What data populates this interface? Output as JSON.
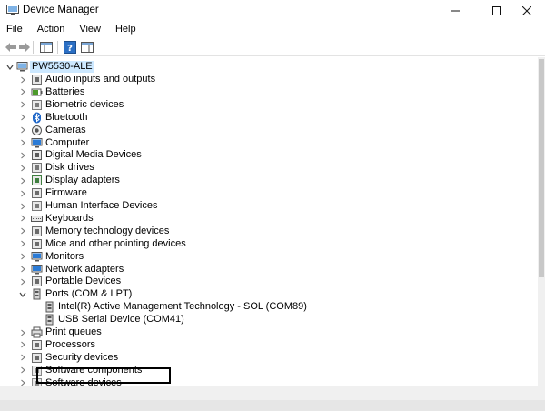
{
  "window": {
    "title": "Device Manager"
  },
  "menu": [
    "File",
    "Action",
    "View",
    "Help"
  ],
  "tree": {
    "root": "PW5530-ALE",
    "items": [
      {
        "label": "Audio inputs and outputs",
        "icon": "speaker-icon"
      },
      {
        "label": "Batteries",
        "icon": "battery-icon"
      },
      {
        "label": "Biometric devices",
        "icon": "biometric-icon"
      },
      {
        "label": "Bluetooth",
        "icon": "bluetooth-icon"
      },
      {
        "label": "Cameras",
        "icon": "camera-icon"
      },
      {
        "label": "Computer",
        "icon": "monitor-icon"
      },
      {
        "label": "Digital Media Devices",
        "icon": "media-device-icon"
      },
      {
        "label": "Disk drives",
        "icon": "disk-icon"
      },
      {
        "label": "Display adapters",
        "icon": "display-adapter-icon"
      },
      {
        "label": "Firmware",
        "icon": "chip-icon"
      },
      {
        "label": "Human Interface Devices",
        "icon": "hid-icon"
      },
      {
        "label": "Keyboards",
        "icon": "keyboard-icon"
      },
      {
        "label": "Memory technology devices",
        "icon": "memory-icon"
      },
      {
        "label": "Mice and other pointing devices",
        "icon": "mouse-icon"
      },
      {
        "label": "Monitors",
        "icon": "monitor-icon"
      },
      {
        "label": "Network adapters",
        "icon": "network-icon"
      },
      {
        "label": "Portable Devices",
        "icon": "portable-device-icon"
      },
      {
        "label": "Ports (COM & LPT)",
        "icon": "port-icon",
        "expanded": true,
        "children": [
          {
            "label": "Intel(R) Active Management Technology - SOL (COM89)",
            "icon": "port-icon"
          },
          {
            "label": "USB Serial Device (COM41)",
            "icon": "port-icon"
          }
        ]
      },
      {
        "label": "Print queues",
        "icon": "printer-icon"
      },
      {
        "label": "Processors",
        "icon": "processor-icon"
      },
      {
        "label": "Security devices",
        "icon": "security-icon"
      },
      {
        "label": "Software components",
        "icon": "software-component-icon"
      },
      {
        "label": "Software devices",
        "icon": "software-device-icon"
      }
    ]
  },
  "colors": {
    "selection": "#cce8ff",
    "icon_blue": "#2b7bd6",
    "icon_gray": "#6b6b6b"
  }
}
